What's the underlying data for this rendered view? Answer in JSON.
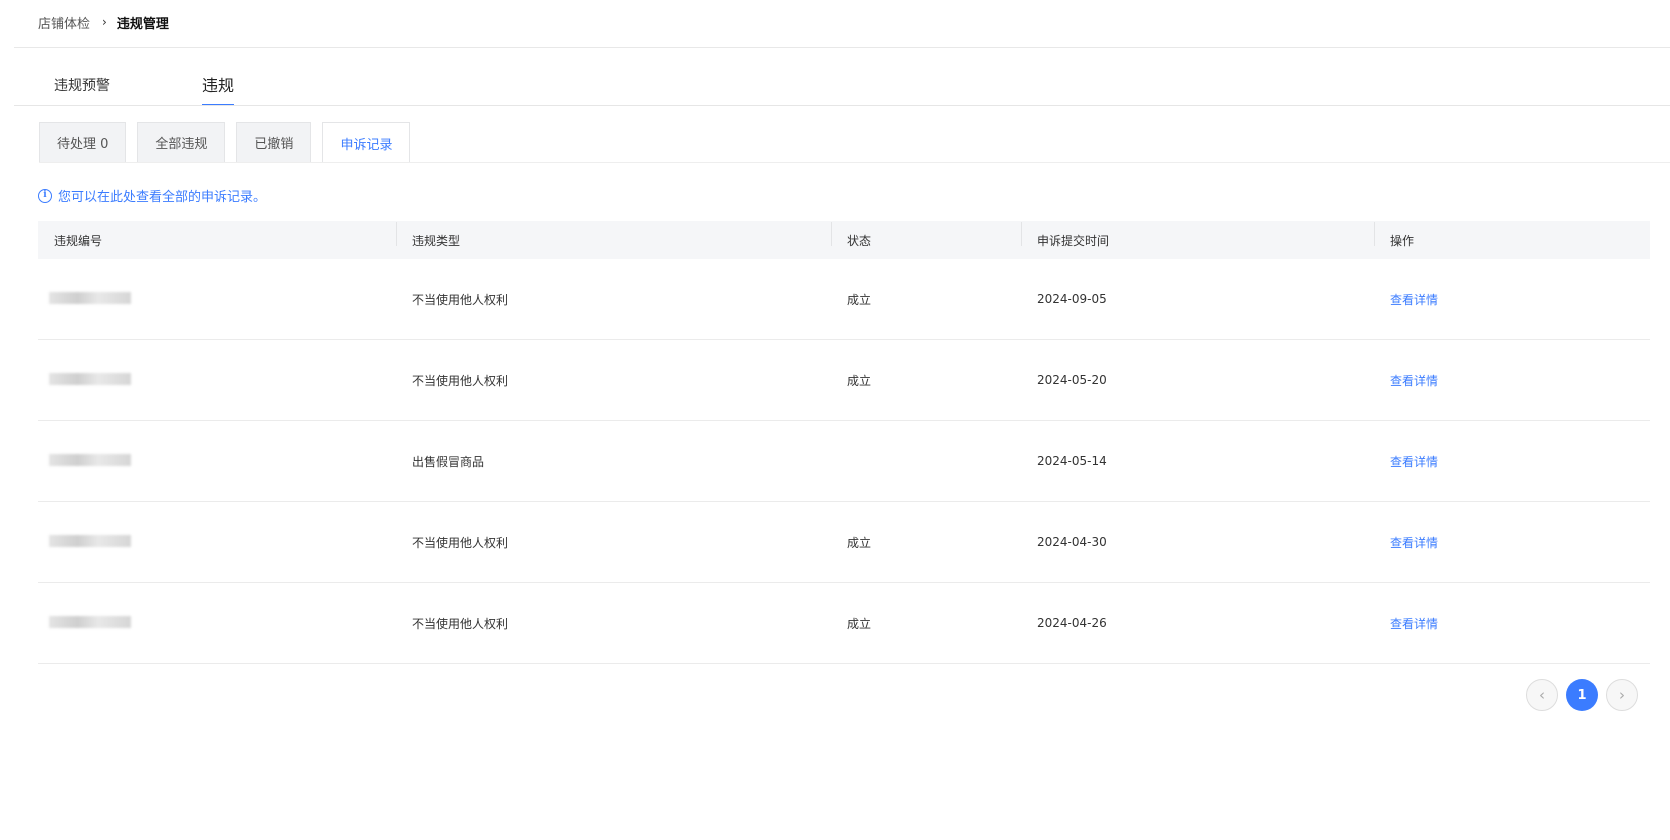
{
  "breadcrumb": {
    "parent": "店铺体检",
    "separator": "›",
    "current": "违规管理"
  },
  "main_tabs": [
    {
      "label": "违规预警",
      "active": false
    },
    {
      "label": "违规",
      "active": true
    }
  ],
  "sub_tabs": [
    {
      "label": "待处理 0",
      "active": false
    },
    {
      "label": "全部违规",
      "active": false
    },
    {
      "label": "已撤销",
      "active": false
    },
    {
      "label": "申诉记录",
      "active": true
    }
  ],
  "notice": {
    "icon": "info-icon",
    "text": "您可以在此处查看全部的申诉记录。"
  },
  "table": {
    "headers": [
      "违规编号",
      "违规类型",
      "状态",
      "申诉提交时间",
      "操作"
    ],
    "rows": [
      {
        "id": "",
        "type": "不当使用他人权利",
        "status": "成立",
        "time": "2024-09-05",
        "action": "查看详情"
      },
      {
        "id": "",
        "type": "不当使用他人权利",
        "status": "成立",
        "time": "2024-05-20",
        "action": "查看详情"
      },
      {
        "id": "",
        "type": "出售假冒商品",
        "status": "",
        "time": "2024-05-14",
        "action": "查看详情"
      },
      {
        "id": "",
        "type": "不当使用他人权利",
        "status": "成立",
        "time": "2024-04-30",
        "action": "查看详情"
      },
      {
        "id": "",
        "type": "不当使用他人权利",
        "status": "成立",
        "time": "2024-04-26",
        "action": "查看详情"
      }
    ]
  },
  "pagination": {
    "prev": "‹",
    "current": "1",
    "next": "›"
  },
  "colors": {
    "accent": "#3b7cff",
    "header_bg": "#f5f6f8",
    "tab_bg": "#f2f3f5"
  }
}
